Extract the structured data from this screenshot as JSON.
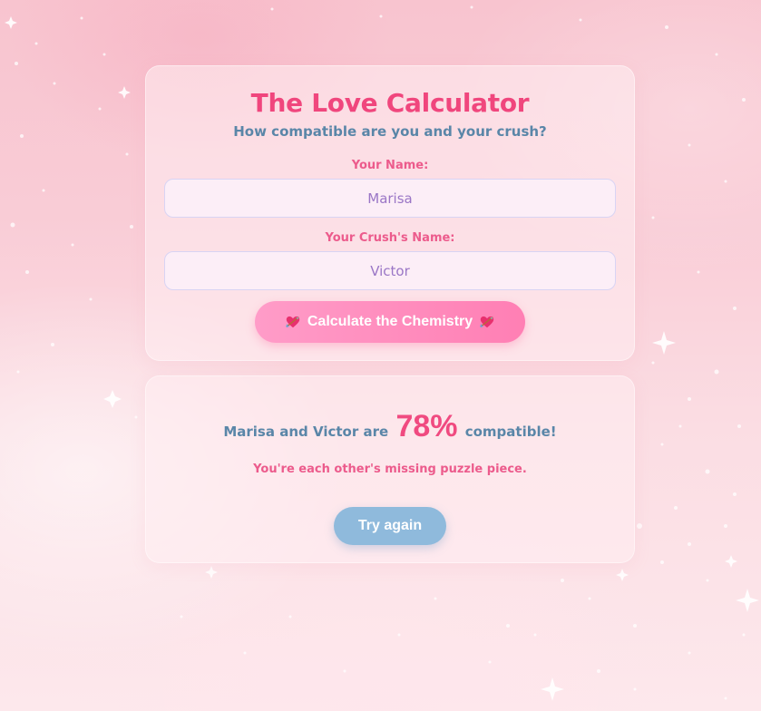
{
  "app": {
    "title": "The Love Calculator",
    "subtitle": "How compatible are you and your crush?"
  },
  "form": {
    "your_name_label": "Your Name:",
    "your_name_value": "Marisa",
    "crush_name_label": "Your Crush's Name:",
    "crush_name_value": "Victor",
    "calculate_button": {
      "label": "Calculate the Chemistry",
      "leading_icon": "heart-arrow-icon",
      "trailing_icon": "heart-arrow-icon"
    }
  },
  "result": {
    "name1": "Marisa",
    "connector": "and",
    "name2": "Victor",
    "verb": "are",
    "percentage": "78%",
    "suffix": "compatible!",
    "message": "You're each other's missing puzzle piece.",
    "try_again_button": "Try again"
  },
  "colors": {
    "title": "#f0467d",
    "subtitle": "#5a86a8",
    "label": "#ec5b8c",
    "calculate_button": "#ff8fbe",
    "try_again_button": "#8fbadc",
    "background": "#f9ccd6"
  }
}
